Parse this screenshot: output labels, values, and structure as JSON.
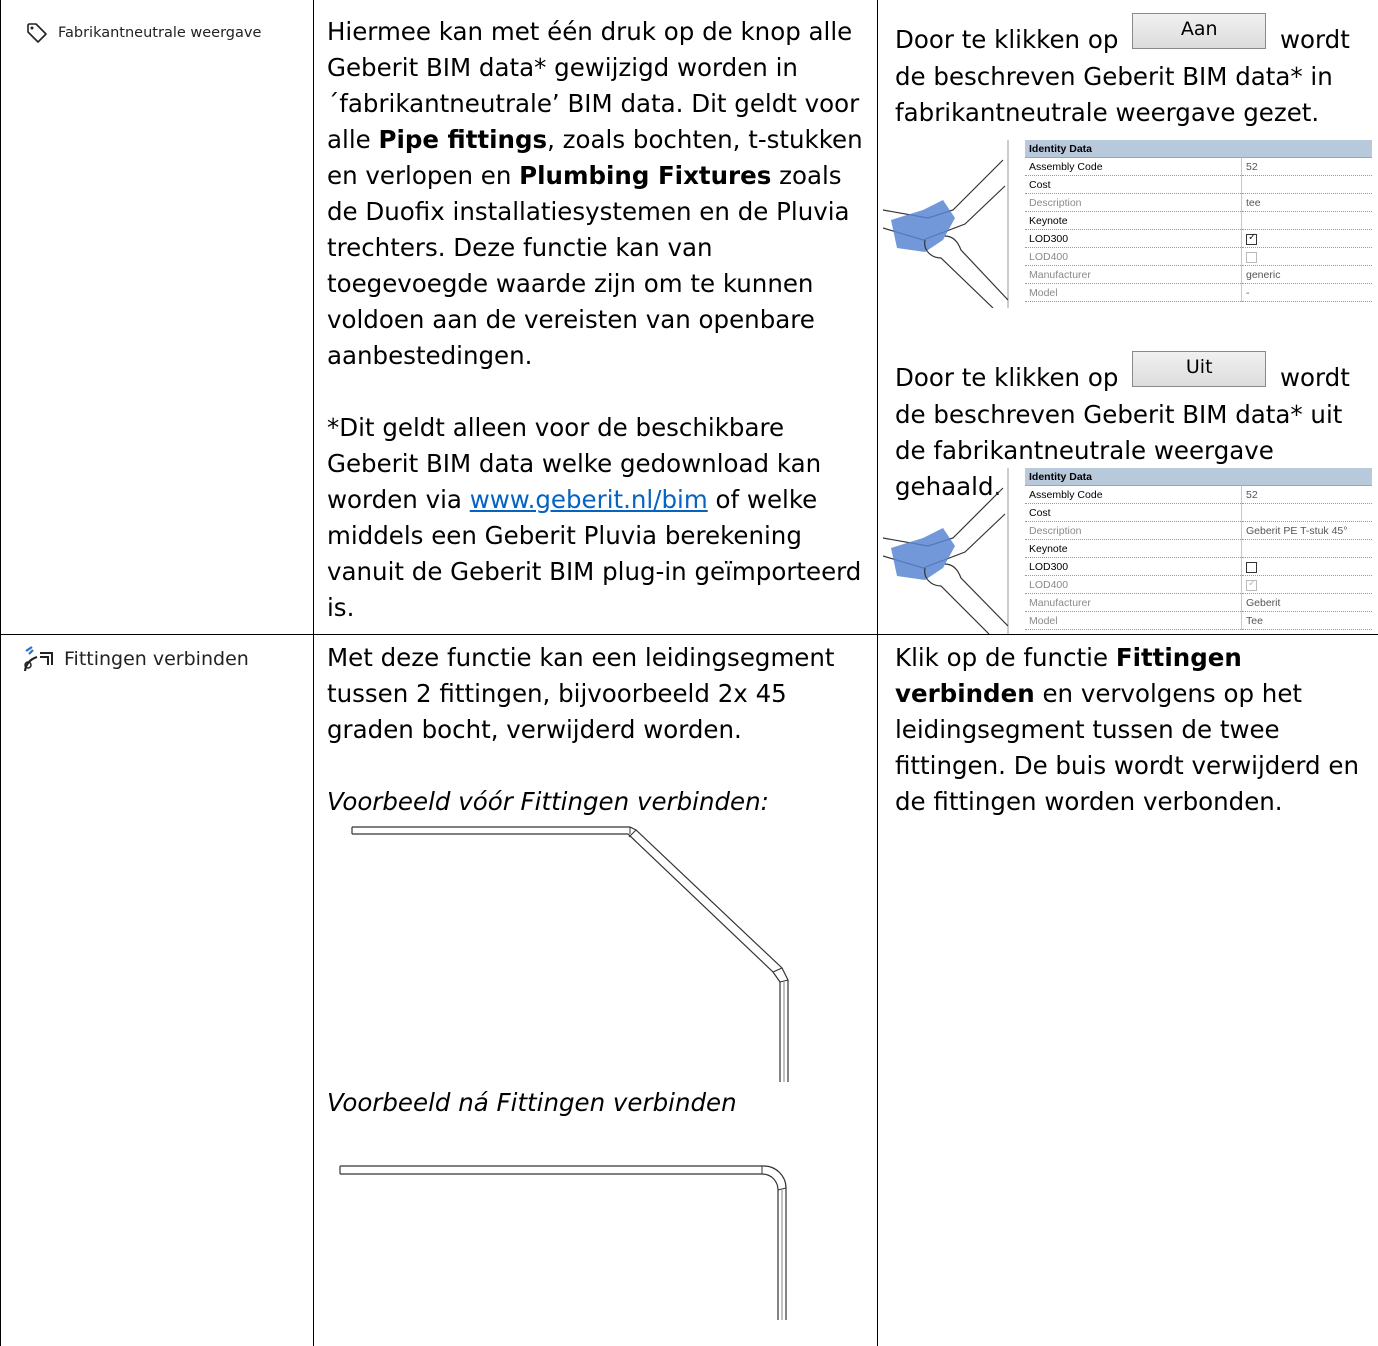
{
  "rows": [
    {
      "tool": {
        "icon": "tag-icon",
        "label": "Fabrikantneutrale weergave"
      },
      "description": {
        "p1": {
          "t1": "Hiermee kan met één druk op de knop alle Geberit BIM data* gewijzigd worden in ´fabrikantneutrale’ BIM data. Dit geldt voor alle ",
          "b1": "Pipe fittings",
          "t2": ", zoals bochten, t-stukken en verlopen en ",
          "b2": "Plumbing Fixtures",
          "t3": " zoals de Duofix installatiesystemen en de Pluvia trechters. Deze functie kan van toegevoegde waarde zijn om te kunnen voldoen aan de vereisten van openbare aanbestedingen."
        },
        "p2": {
          "t1": "*Dit geldt alleen voor de beschikbare Geberit BIM data welke gedownload kan worden via ",
          "link": "www.geberit.nl/bim",
          "t2": " of welke middels een Geberit Pluvia berekening vanuit de Geberit BIM plug-in geïmporteerd is."
        }
      },
      "instructions": {
        "on": {
          "before": "Door te klikken op",
          "button": "Aan",
          "after": "wordt de beschreven Geberit BIM data* in fabrikantneutrale weergave gezet.",
          "properties": {
            "header": "Identity Data",
            "rows": [
              {
                "key": "Assembly Code",
                "value": "52",
                "dim": false
              },
              {
                "key": "Cost",
                "value": "",
                "dim": false
              },
              {
                "key": "Description",
                "value": "tee",
                "dim": true
              },
              {
                "key": "Keynote",
                "value": "",
                "dim": false
              },
              {
                "key": "LOD300",
                "checkbox": true,
                "checked": true,
                "dim": false
              },
              {
                "key": "LOD400",
                "checkbox": true,
                "checked": false,
                "dim": true
              },
              {
                "key": "Manufacturer",
                "value": "generic",
                "dim": true
              },
              {
                "key": "Model",
                "value": "-",
                "dim": true
              }
            ]
          }
        },
        "off": {
          "before": "Door te klikken op",
          "button": "Uit",
          "after": "wordt de beschreven Geberit BIM data* uit de fabrikantneutrale weergave gehaald.",
          "properties": {
            "header": "Identity Data",
            "rows": [
              {
                "key": "Assembly Code",
                "value": "52",
                "dim": false
              },
              {
                "key": "Cost",
                "value": "",
                "dim": false
              },
              {
                "key": "Description",
                "value": "Geberit PE T-stuk 45°",
                "dim": true
              },
              {
                "key": "Keynote",
                "value": "",
                "dim": false
              },
              {
                "key": "LOD300",
                "checkbox": true,
                "checked": false,
                "dim": false
              },
              {
                "key": "LOD400",
                "checkbox": true,
                "checked": true,
                "dim": true
              },
              {
                "key": "Manufacturer",
                "value": "Geberit",
                "dim": true
              },
              {
                "key": "Model",
                "value": "Tee",
                "dim": true
              }
            ]
          }
        }
      }
    },
    {
      "tool": {
        "icon": "pipe-connect-icon",
        "label": "Fittingen verbinden"
      },
      "description": {
        "p1": "Met deze functie kan een leidingsegment tussen 2 fittingen, bijvoorbeeld 2x 45 graden bocht, verwijderd worden.",
        "example_before": "Voorbeeld vóór Fittingen verbinden:",
        "example_after": "Voorbeeld ná Fittingen verbinden"
      },
      "instructions": {
        "t1": "Klik op de functie ",
        "b1": "Fittingen verbinden",
        "t2": " en vervolgens op het leidingsegment tussen de twee fittingen. De buis wordt verwijderd en de fittingen worden verbonden."
      }
    }
  ]
}
